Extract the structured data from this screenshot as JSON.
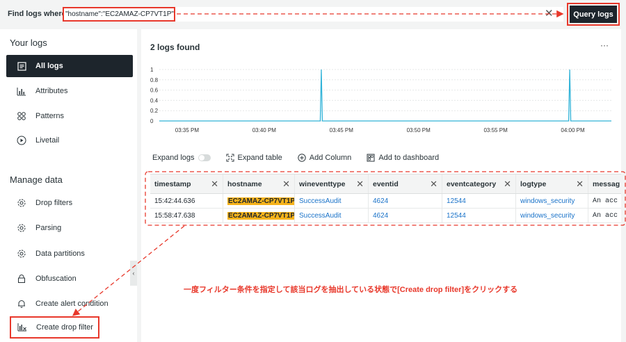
{
  "query": {
    "label": "Find logs where",
    "value": "\"hostname\":\"EC2AMAZ-CP7VT1P\"",
    "clear_icon": "close-icon",
    "submit_label": "Query logs"
  },
  "sidebar": {
    "your_logs_title": "Your logs",
    "your_logs": [
      {
        "label": "All logs",
        "icon": "list-icon",
        "active": true
      },
      {
        "label": "Attributes",
        "icon": "bar-chart-icon"
      },
      {
        "label": "Patterns",
        "icon": "patterns-icon"
      },
      {
        "label": "Livetail",
        "icon": "play-icon"
      }
    ],
    "manage_title": "Manage data",
    "manage": [
      {
        "label": "Drop filters",
        "icon": "gear-icon"
      },
      {
        "label": "Parsing",
        "icon": "gear-icon"
      },
      {
        "label": "Data partitions",
        "icon": "gear-icon"
      },
      {
        "label": "Obfuscation",
        "icon": "lock-icon"
      },
      {
        "label": "Create alert condition",
        "icon": "bell-icon"
      },
      {
        "label": "Create drop filter",
        "icon": "drop-filter-icon"
      }
    ],
    "collapse_glyph": "‹"
  },
  "main": {
    "title": "2 logs found",
    "menu_glyph": "···",
    "toolbar": {
      "expand_logs": "Expand logs",
      "expand_table": "Expand table",
      "add_column": "Add Column",
      "add_dashboard": "Add to dashboard"
    },
    "table": {
      "columns": [
        "timestamp",
        "hostname",
        "wineventtype",
        "eventid",
        "eventcategory",
        "logtype",
        "messag"
      ],
      "rows": [
        [
          "15:42:44.636",
          "EC2AMAZ-CP7VT1P",
          "SuccessAudit",
          "4624",
          "12544",
          "windows_security",
          "An acc"
        ],
        [
          "15:58:47.638",
          "EC2AMAZ-CP7VT1P",
          "SuccessAudit",
          "4624",
          "12544",
          "windows_security",
          "An acc"
        ]
      ]
    }
  },
  "chart_data": {
    "type": "line",
    "y_ticks": [
      "1",
      "0.8",
      "0.6",
      "0.4",
      "0.2",
      "0"
    ],
    "ylim": [
      0,
      1
    ],
    "x_ticks": [
      "03:35 PM",
      "03:40 PM",
      "03:45 PM",
      "03:50 PM",
      "03:55 PM",
      "04:00 PM"
    ],
    "x_tick_minutes": [
      0,
      5,
      10,
      15,
      20,
      25
    ],
    "x_range_minutes": [
      -1.8,
      27.5
    ],
    "spikes_at_minutes": [
      8.7,
      24.8
    ],
    "series": [
      {
        "values": [
          0,
          0,
          1,
          0,
          0,
          1,
          0,
          0
        ]
      }
    ],
    "grid": true,
    "color": "#31b3d8"
  },
  "annotation": {
    "note": "一度フィルター条件を指定して該当ログを抽出している状態で[Create drop filter]をクリックする",
    "color": "#e8382b"
  }
}
